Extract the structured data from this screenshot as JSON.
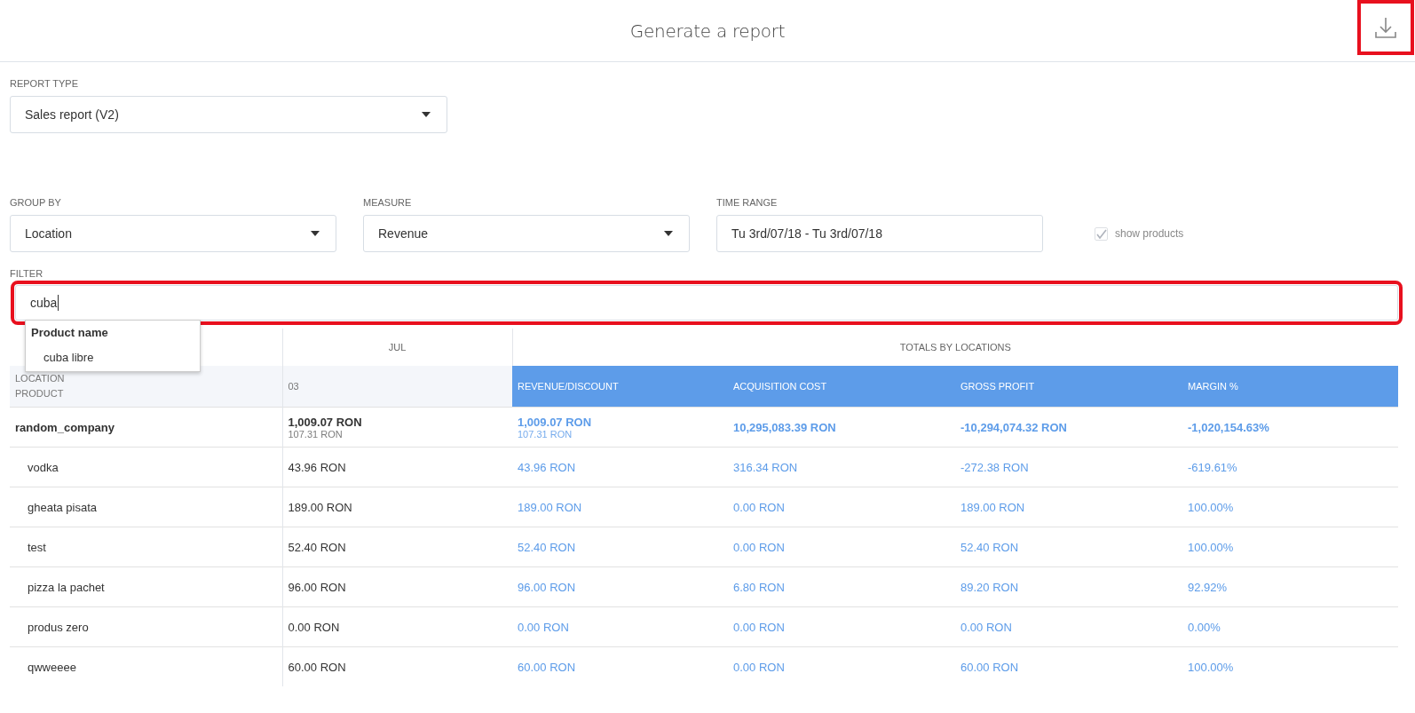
{
  "header": {
    "title": "Generate a report",
    "download_button": {
      "highlighted": true
    }
  },
  "report_type": {
    "kind": "select",
    "label": "REPORT TYPE",
    "value": "Sales report (V2)"
  },
  "controls": [
    {
      "kind": "select",
      "label": "GROUP BY",
      "value": "Location"
    },
    {
      "kind": "select",
      "label": "MEASURE",
      "value": "Revenue"
    },
    {
      "kind": "input",
      "label": "TIME RANGE",
      "value": "Tu 3rd/07/18 - Tu 3rd/07/18"
    },
    {
      "kind": "checkbox",
      "label": "show products",
      "checked": true,
      "disabled": true
    }
  ],
  "filter": {
    "label": "FILTER",
    "value": "cuba",
    "highlighted": true,
    "suggestions": {
      "heading": "Product name",
      "items": [
        "cuba libre"
      ]
    }
  },
  "table": {
    "month_header": "JUL",
    "totals_header": "TOTALS BY LOCATIONS",
    "row_header": [
      "LOCATION",
      "PRODUCT"
    ],
    "day_column": "03",
    "total_columns": [
      "REVENUE/DISCOUNT",
      "ACQUISITION COST",
      "GROSS PROFIT",
      "MARGIN %"
    ],
    "rows": [
      {
        "kind": "group",
        "name": "random_company",
        "cells": [
          {
            "main": "1,009.07 RON",
            "sub": "107.31 RON"
          },
          {
            "main": "1,009.07 RON",
            "sub": "107.31 RON"
          },
          {
            "main": "10,295,083.39 RON"
          },
          {
            "main": "-10,294,074.32 RON"
          },
          {
            "main": "-1,020,154.63%"
          }
        ]
      },
      {
        "kind": "product",
        "name": "vodka",
        "cells": [
          {
            "main": "43.96 RON"
          },
          {
            "main": "43.96 RON"
          },
          {
            "main": "316.34 RON"
          },
          {
            "main": "-272.38 RON"
          },
          {
            "main": "-619.61%"
          }
        ]
      },
      {
        "kind": "product",
        "name": "gheata pisata",
        "cells": [
          {
            "main": "189.00 RON"
          },
          {
            "main": "189.00 RON"
          },
          {
            "main": "0.00 RON"
          },
          {
            "main": "189.00 RON"
          },
          {
            "main": "100.00%"
          }
        ]
      },
      {
        "kind": "product",
        "name": "test",
        "cells": [
          {
            "main": "52.40 RON"
          },
          {
            "main": "52.40 RON"
          },
          {
            "main": "0.00 RON"
          },
          {
            "main": "52.40 RON"
          },
          {
            "main": "100.00%"
          }
        ]
      },
      {
        "kind": "product",
        "name": "pizza la pachet",
        "cells": [
          {
            "main": "96.00 RON"
          },
          {
            "main": "96.00 RON"
          },
          {
            "main": "6.80 RON"
          },
          {
            "main": "89.20 RON"
          },
          {
            "main": "92.92%"
          }
        ]
      },
      {
        "kind": "product",
        "name": "produs zero",
        "cells": [
          {
            "main": "0.00 RON"
          },
          {
            "main": "0.00 RON"
          },
          {
            "main": "0.00 RON"
          },
          {
            "main": "0.00 RON"
          },
          {
            "main": "0.00%"
          }
        ]
      },
      {
        "kind": "product",
        "name": "qwweeee",
        "cells": [
          {
            "main": "60.00 RON"
          },
          {
            "main": "60.00 RON"
          },
          {
            "main": "0.00 RON"
          },
          {
            "main": "60.00 RON"
          },
          {
            "main": "100.00%"
          }
        ]
      }
    ]
  }
}
